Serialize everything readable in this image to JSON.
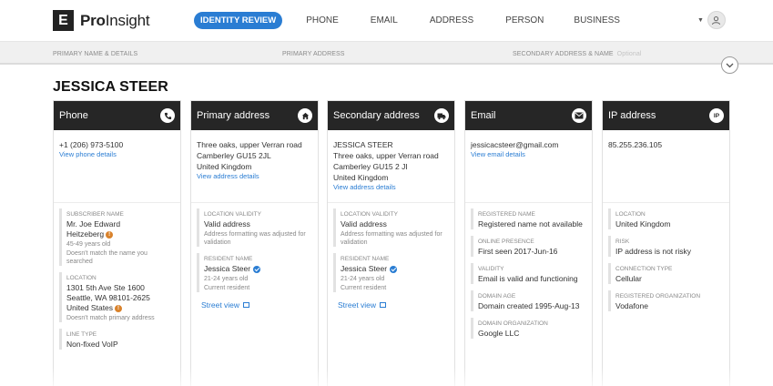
{
  "header": {
    "logo_letter": "E",
    "logo_bold": "Pro",
    "logo_rest": "Insight",
    "nav": [
      "IDENTITY REVIEW",
      "PHONE",
      "EMAIL",
      "ADDRESS",
      "PERSON",
      "BUSINESS"
    ],
    "accent_color": "#2a7dd3"
  },
  "steps": {
    "s1": "PRIMARY NAME & DETAILS",
    "s2": "PRIMARY ADDRESS",
    "s3": "SECONDARY ADDRESS & NAME",
    "s3_optional": "Optional"
  },
  "person_name": "JESSICA STEER",
  "cards": {
    "phone": {
      "title": "Phone",
      "icon": "phone-icon",
      "value": "+1 (206) 973-5100",
      "link": "View phone details",
      "subscriber_label": "SUBSCRIBER NAME",
      "subscriber_line1": "Mr. Joe Edward",
      "subscriber_line2": "Heitzeberg",
      "subscriber_age": "45-49 years old",
      "subscriber_note": "Doesn't match the name you searched",
      "location_label": "LOCATION",
      "location_line1": "1301 5th Ave Ste 1600",
      "location_line2": "Seattle, WA 98101-2625",
      "location_line3": "United States",
      "location_note": "Doesn't match primary address",
      "linetype_label": "LINE TYPE",
      "linetype_value": "Non-fixed VoIP"
    },
    "primary": {
      "title": "Primary address",
      "icon": "home-icon",
      "line1": "Three oaks, upper Verran road",
      "line2": "Camberley GU15 2JL",
      "line3": "United Kingdom",
      "link": "View address details",
      "validity_label": "LOCATION VALIDITY",
      "validity_value": "Valid address",
      "validity_note": "Address formatting was adjusted for validation",
      "resident_label": "RESIDENT NAME",
      "resident_value": "Jessica Steer",
      "resident_age": "21-24 years old",
      "resident_status": "Current resident",
      "street": "Street view"
    },
    "secondary": {
      "title": "Secondary address",
      "icon": "truck-icon",
      "line0": "JESSICA STEER",
      "line1": "Three oaks, upper Verran road",
      "line2": "Camberley GU15 2 JI",
      "line3": "United Kingdom",
      "link": "View address details",
      "validity_label": "LOCATION VALIDITY",
      "validity_value": "Valid address",
      "validity_note": "Address formatting was adjusted for validation",
      "resident_label": "RESIDENT NAME",
      "resident_value": "Jessica Steer",
      "resident_age": "21-24 years old",
      "resident_status": "Current resident",
      "street": "Street view"
    },
    "email": {
      "title": "Email",
      "icon": "mail-icon",
      "value": "jessicacsteer@gmail.com",
      "link": "View email details",
      "registered_label": "REGISTERED NAME",
      "registered_value": "Registered name not available",
      "presence_label": "ONLINE PRESENCE",
      "presence_value": "First seen 2017-Jun-16",
      "validity_label": "VALIDITY",
      "validity_value": "Email is valid and functioning",
      "domain_age_label": "DOMAIN AGE",
      "domain_age_value": "Domain created 1995-Aug-13",
      "domain_org_label": "DOMAIN ORGANIZATION",
      "domain_org_value": "Google LLC"
    },
    "ip": {
      "title": "IP address",
      "icon_text": "IP",
      "value": "85.255.236.105",
      "location_label": "LOCATION",
      "location_value": "United Kingdom",
      "risk_label": "RISK",
      "risk_value": "IP address is not risky",
      "conn_label": "CONNECTION TYPE",
      "conn_value": "Cellular",
      "org_label": "REGISTERED ORGANIZATION",
      "org_value": "Vodafone"
    }
  }
}
